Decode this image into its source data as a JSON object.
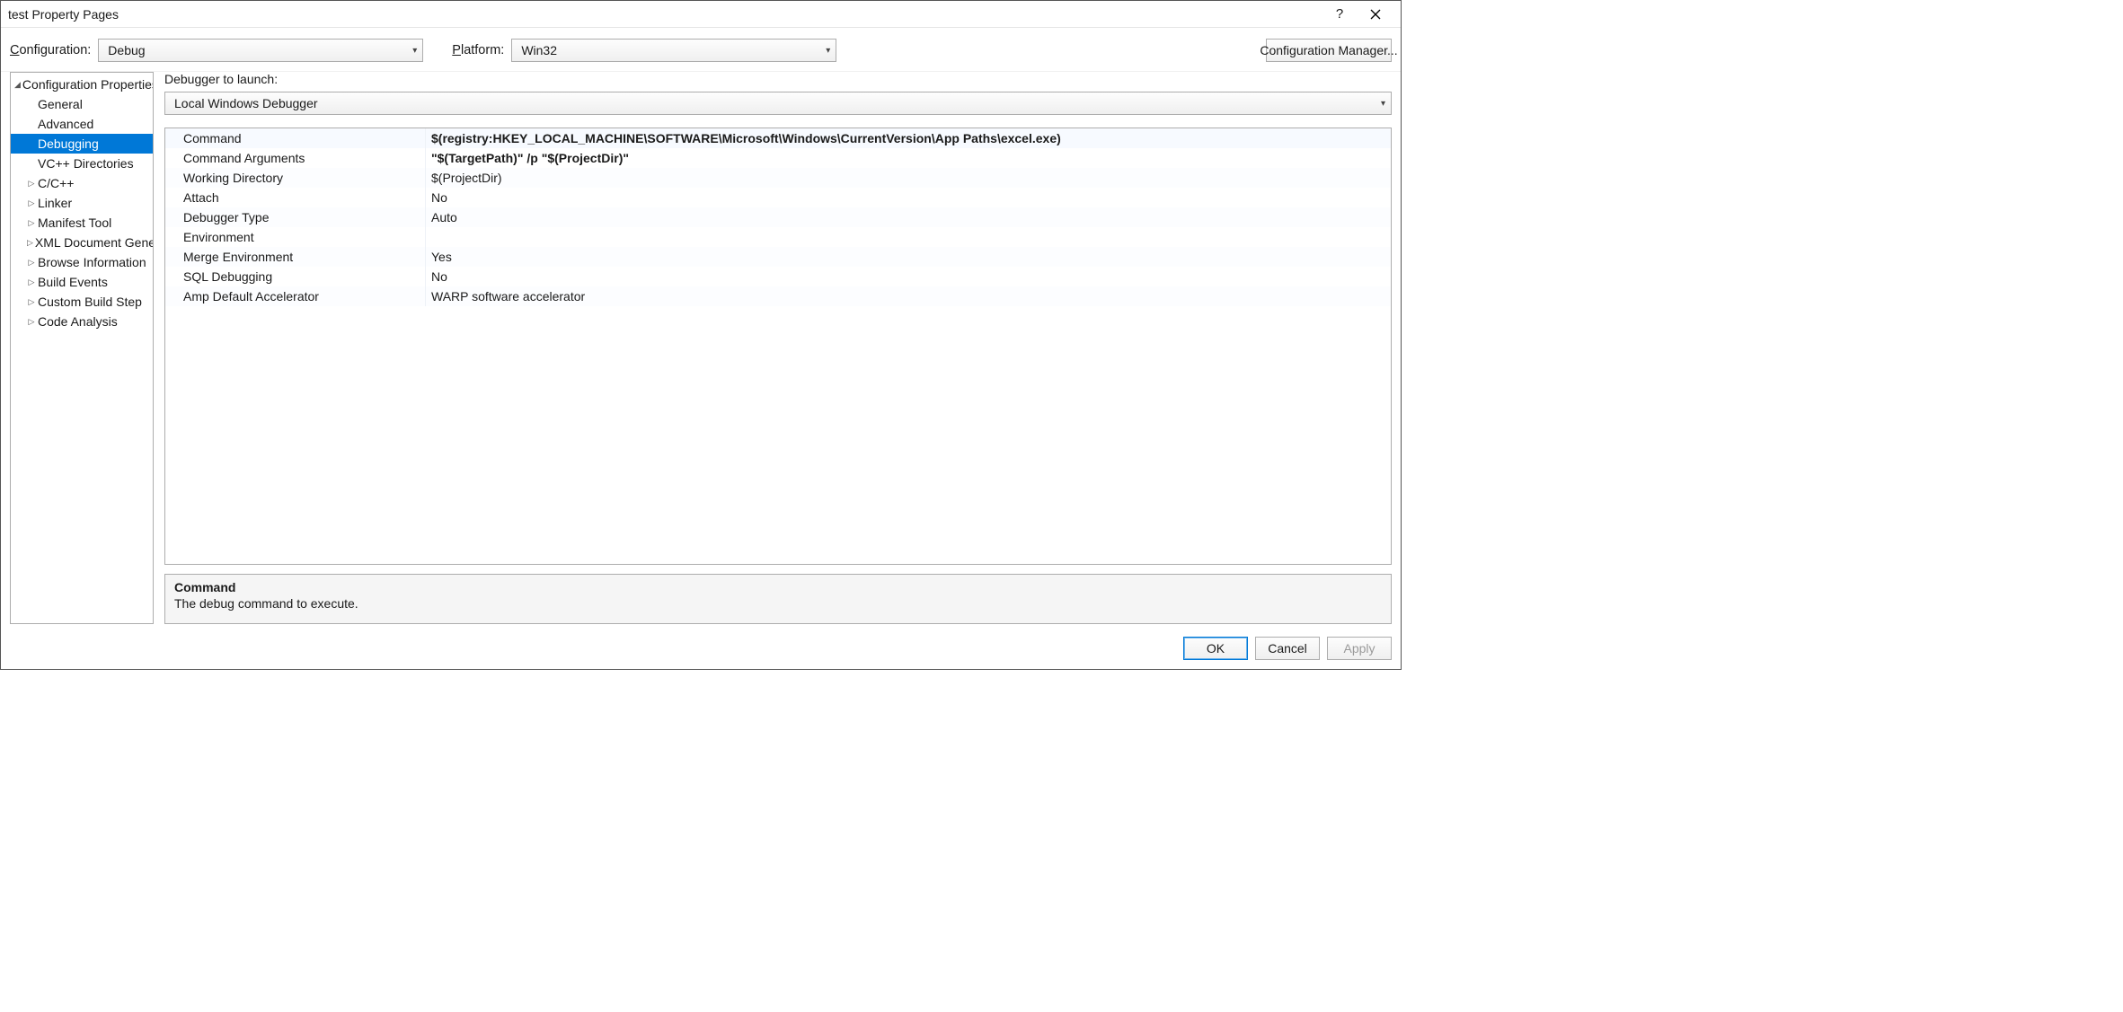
{
  "window": {
    "title": "test Property Pages"
  },
  "configRow": {
    "configLabelPrefix": "C",
    "configLabelRest": "onfiguration:",
    "configValue": "Debug",
    "platformLabelPrefix": "P",
    "platformLabelRest": "latform:",
    "platformValue": "Win32",
    "configMgrLabel": "Configuration Manager..."
  },
  "tree": {
    "root": "Configuration Properties",
    "items": [
      {
        "label": "General",
        "expander": "",
        "selected": false
      },
      {
        "label": "Advanced",
        "expander": "",
        "selected": false
      },
      {
        "label": "Debugging",
        "expander": "",
        "selected": true
      },
      {
        "label": "VC++ Directories",
        "expander": "",
        "selected": false
      },
      {
        "label": "C/C++",
        "expander": "▷",
        "selected": false
      },
      {
        "label": "Linker",
        "expander": "▷",
        "selected": false
      },
      {
        "label": "Manifest Tool",
        "expander": "▷",
        "selected": false
      },
      {
        "label": "XML Document Generator",
        "expander": "▷",
        "selected": false
      },
      {
        "label": "Browse Information",
        "expander": "▷",
        "selected": false
      },
      {
        "label": "Build Events",
        "expander": "▷",
        "selected": false
      },
      {
        "label": "Custom Build Step",
        "expander": "▷",
        "selected": false
      },
      {
        "label": "Code Analysis",
        "expander": "▷",
        "selected": false
      }
    ]
  },
  "main": {
    "launcherLabel": "Debugger to launch:",
    "launcherValue": "Local Windows Debugger",
    "grid": [
      {
        "name": "Command",
        "value": "$(registry:HKEY_LOCAL_MACHINE\\SOFTWARE\\Microsoft\\Windows\\CurrentVersion\\App Paths\\excel.exe)",
        "bold": true
      },
      {
        "name": "Command Arguments",
        "value": "\"$(TargetPath)\" /p \"$(ProjectDir)\"",
        "bold": true
      },
      {
        "name": "Working Directory",
        "value": "$(ProjectDir)",
        "bold": false
      },
      {
        "name": "Attach",
        "value": "No",
        "bold": false
      },
      {
        "name": "Debugger Type",
        "value": "Auto",
        "bold": false
      },
      {
        "name": "Environment",
        "value": "",
        "bold": false
      },
      {
        "name": "Merge Environment",
        "value": "Yes",
        "bold": false
      },
      {
        "name": "SQL Debugging",
        "value": "No",
        "bold": false
      },
      {
        "name": "Amp Default Accelerator",
        "value": "WARP software accelerator",
        "bold": false
      }
    ],
    "descTitle": "Command",
    "descText": "The debug command to execute."
  },
  "buttons": {
    "ok": "OK",
    "cancel": "Cancel",
    "apply": "Apply"
  }
}
